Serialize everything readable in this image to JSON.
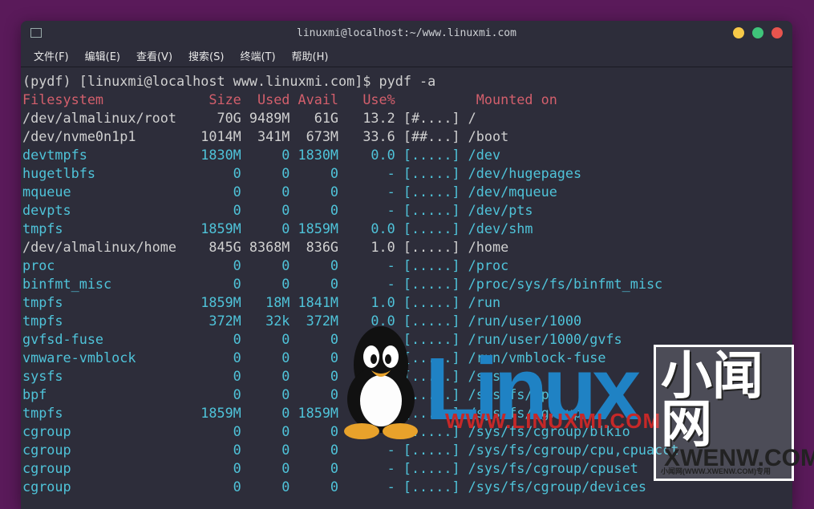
{
  "window": {
    "title": "linuxmi@localhost:~/www.linuxmi.com"
  },
  "menubar": [
    "文件(F)",
    "编辑(E)",
    "查看(V)",
    "搜索(S)",
    "终端(T)",
    "帮助(H)"
  ],
  "prompt": {
    "prefix": "(pydf) [linuxmi@localhost www.linuxmi.com]$ ",
    "command": "pydf -a"
  },
  "header": {
    "fs": "Filesystem",
    "size": "Size",
    "used": "Used",
    "avail": "Avail",
    "usep": "Use%",
    "mounted": "Mounted on"
  },
  "rows": [
    {
      "fs": "/dev/almalinux/root",
      "size": "70G",
      "used": "9489M",
      "avail": "61G",
      "usep": "13.2",
      "bar": "[#....]",
      "mount": "/",
      "hl": false
    },
    {
      "fs": "/dev/nvme0n1p1",
      "size": "1014M",
      "used": "341M",
      "avail": "673M",
      "usep": "33.6",
      "bar": "[##...]",
      "mount": "/boot",
      "hl": false
    },
    {
      "fs": "devtmpfs",
      "size": "1830M",
      "used": "0",
      "avail": "1830M",
      "usep": "0.0",
      "bar": "[.....]",
      "mount": "/dev",
      "hl": true
    },
    {
      "fs": "hugetlbfs",
      "size": "0",
      "used": "0",
      "avail": "0",
      "usep": "-",
      "bar": "[.....]",
      "mount": "/dev/hugepages",
      "hl": true
    },
    {
      "fs": "mqueue",
      "size": "0",
      "used": "0",
      "avail": "0",
      "usep": "-",
      "bar": "[.....]",
      "mount": "/dev/mqueue",
      "hl": true
    },
    {
      "fs": "devpts",
      "size": "0",
      "used": "0",
      "avail": "0",
      "usep": "-",
      "bar": "[.....]",
      "mount": "/dev/pts",
      "hl": true
    },
    {
      "fs": "tmpfs",
      "size": "1859M",
      "used": "0",
      "avail": "1859M",
      "usep": "0.0",
      "bar": "[.....]",
      "mount": "/dev/shm",
      "hl": true
    },
    {
      "fs": "/dev/almalinux/home",
      "size": "845G",
      "used": "8368M",
      "avail": "836G",
      "usep": "1.0",
      "bar": "[.....]",
      "mount": "/home",
      "hl": false
    },
    {
      "fs": "proc",
      "size": "0",
      "used": "0",
      "avail": "0",
      "usep": "-",
      "bar": "[.....]",
      "mount": "/proc",
      "hl": true
    },
    {
      "fs": "binfmt_misc",
      "size": "0",
      "used": "0",
      "avail": "0",
      "usep": "-",
      "bar": "[.....]",
      "mount": "/proc/sys/fs/binfmt_misc",
      "hl": true
    },
    {
      "fs": "tmpfs",
      "size": "1859M",
      "used": "18M",
      "avail": "1841M",
      "usep": "1.0",
      "bar": "[.....]",
      "mount": "/run",
      "hl": true
    },
    {
      "fs": "tmpfs",
      "size": "372M",
      "used": "32k",
      "avail": "372M",
      "usep": "0.0",
      "bar": "[.....]",
      "mount": "/run/user/1000",
      "hl": true
    },
    {
      "fs": "gvfsd-fuse",
      "size": "0",
      "used": "0",
      "avail": "0",
      "usep": "-",
      "bar": "[.....]",
      "mount": "/run/user/1000/gvfs",
      "hl": true
    },
    {
      "fs": "vmware-vmblock",
      "size": "0",
      "used": "0",
      "avail": "0",
      "usep": "-",
      "bar": "[.....]",
      "mount": "/run/vmblock-fuse",
      "hl": true
    },
    {
      "fs": "sysfs",
      "size": "0",
      "used": "0",
      "avail": "0",
      "usep": "-",
      "bar": "[.....]",
      "mount": "/sys",
      "hl": true
    },
    {
      "fs": "bpf",
      "size": "0",
      "used": "0",
      "avail": "0",
      "usep": "-",
      "bar": "[.....]",
      "mount": "/sys/fs/bpf",
      "hl": true
    },
    {
      "fs": "tmpfs",
      "size": "1859M",
      "used": "0",
      "avail": "1859M",
      "usep": "0.0",
      "bar": "[.....]",
      "mount": "/sys/fs/cgroup",
      "hl": true
    },
    {
      "fs": "cgroup",
      "size": "0",
      "used": "0",
      "avail": "0",
      "usep": "-",
      "bar": "[.....]",
      "mount": "/sys/fs/cgroup/blkio",
      "hl": true
    },
    {
      "fs": "cgroup",
      "size": "0",
      "used": "0",
      "avail": "0",
      "usep": "-",
      "bar": "[.....]",
      "mount": "/sys/fs/cgroup/cpu,cpuacct",
      "hl": true
    },
    {
      "fs": "cgroup",
      "size": "0",
      "used": "0",
      "avail": "0",
      "usep": "-",
      "bar": "[.....]",
      "mount": "/sys/fs/cgroup/cpuset",
      "hl": true
    },
    {
      "fs": "cgroup",
      "size": "0",
      "used": "0",
      "avail": "0",
      "usep": "-",
      "bar": "[.....]",
      "mount": "/sys/fs/cgroup/devices",
      "hl": true
    }
  ],
  "overlay": {
    "linux_word": "Linux",
    "linux_url": "WWW.LINUXMI.COM",
    "badge_cn": "小闻网",
    "badge_xw": "XWENW.COM",
    "badge_sub": "小闻网(WWW.XWENW.COM)专用"
  }
}
